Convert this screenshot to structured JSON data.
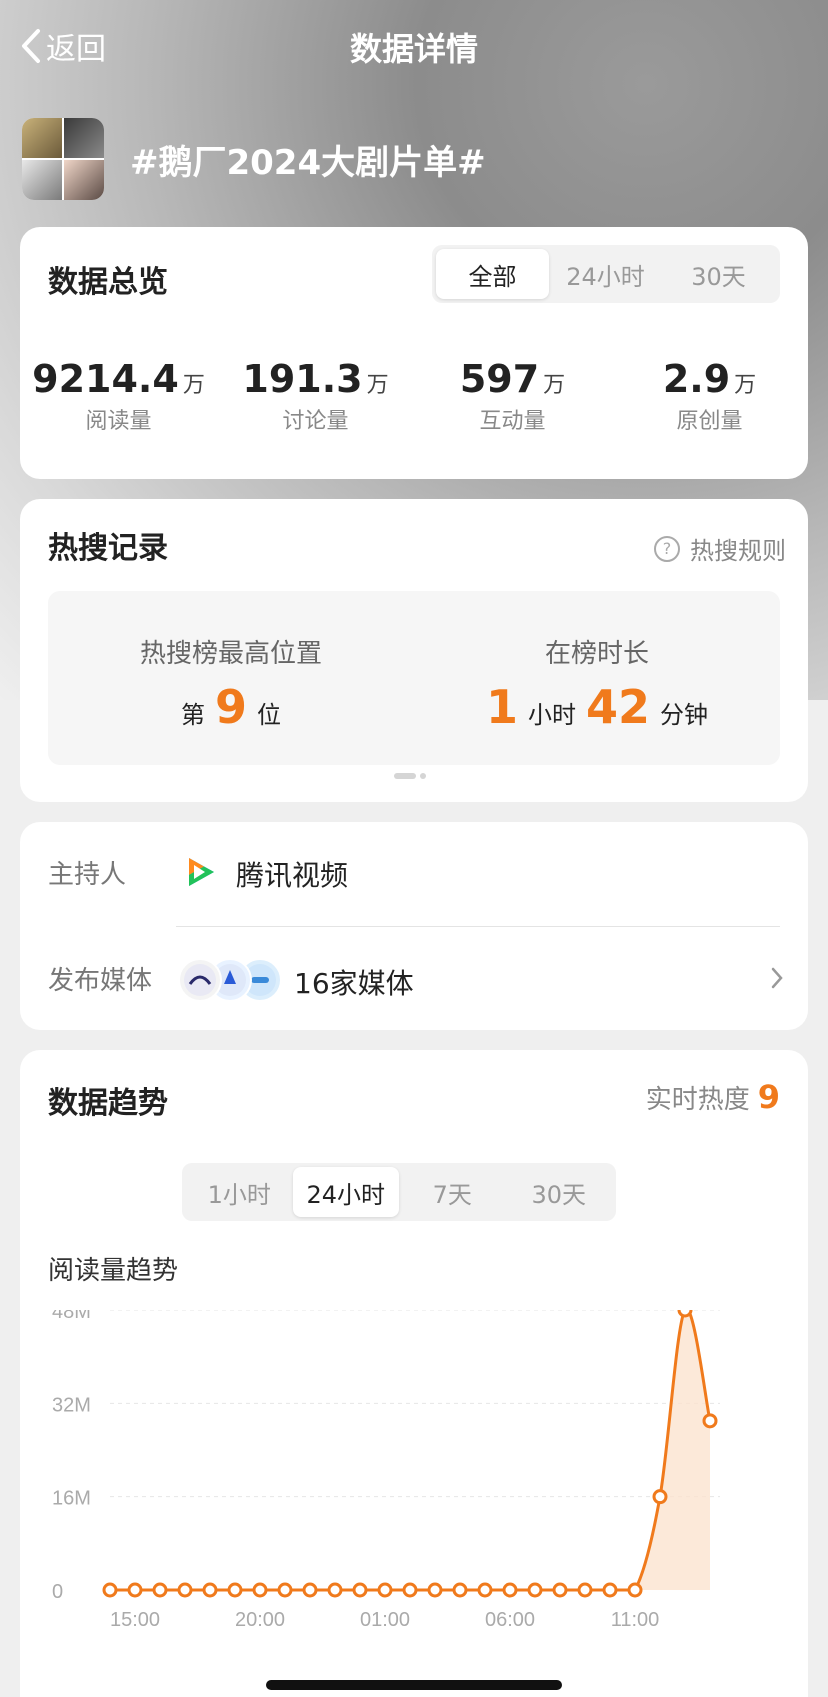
{
  "nav": {
    "back_label": "返回",
    "title": "数据详情"
  },
  "topic": {
    "name": "#鹅厂2024大剧片单#"
  },
  "overview": {
    "title": "数据总览",
    "tabs": [
      "全部",
      "24小时",
      "30天"
    ],
    "stats": [
      {
        "value": "9214.4",
        "unit": "万",
        "label": "阅读量"
      },
      {
        "value": "191.3",
        "unit": "万",
        "label": "讨论量"
      },
      {
        "value": "597",
        "unit": "万",
        "label": "互动量"
      },
      {
        "value": "2.9",
        "unit": "万",
        "label": "原创量"
      }
    ]
  },
  "hot": {
    "title": "热搜记录",
    "rules_label": "热搜规则",
    "peak_label": "热搜榜最高位置",
    "peak_prefix": "第",
    "peak_value": "9",
    "peak_suffix": "位",
    "duration_label": "在榜时长",
    "hours": "1",
    "hours_unit": "小时",
    "minutes": "42",
    "minutes_unit": "分钟"
  },
  "host": {
    "host_label": "主持人",
    "host_name": "腾讯视频",
    "media_label": "发布媒体",
    "media_text": "16家媒体"
  },
  "trend": {
    "title": "数据趋势",
    "realtime_label": "实时热度",
    "realtime_value": "9",
    "tabs": [
      "1小时",
      "24小时",
      "7天",
      "30天"
    ],
    "subtitle": "阅读量趋势"
  },
  "colors": {
    "accent": "#f07a1c",
    "area_fill": "#fbe3d0"
  },
  "chart_data": {
    "type": "area",
    "title": "阅读量趋势",
    "yticks": [
      "0",
      "16M",
      "32M",
      "48M"
    ],
    "ylim": [
      0,
      48
    ],
    "xticks": [
      "15:00",
      "20:00",
      "01:00",
      "06:00",
      "11:00"
    ],
    "x": [
      "14:00",
      "15:00",
      "16:00",
      "17:00",
      "18:00",
      "19:00",
      "20:00",
      "21:00",
      "22:00",
      "23:00",
      "00:00",
      "01:00",
      "02:00",
      "03:00",
      "04:00",
      "05:00",
      "06:00",
      "07:00",
      "08:00",
      "09:00",
      "10:00",
      "11:00"
    ],
    "series": [
      {
        "values": [
          0,
          0,
          0,
          0,
          0,
          0,
          0,
          0,
          0,
          0,
          0,
          0,
          0,
          0,
          0,
          0,
          0,
          0,
          0,
          0,
          0,
          0,
          16,
          48,
          29
        ]
      }
    ],
    "grid": true,
    "legend": false
  }
}
